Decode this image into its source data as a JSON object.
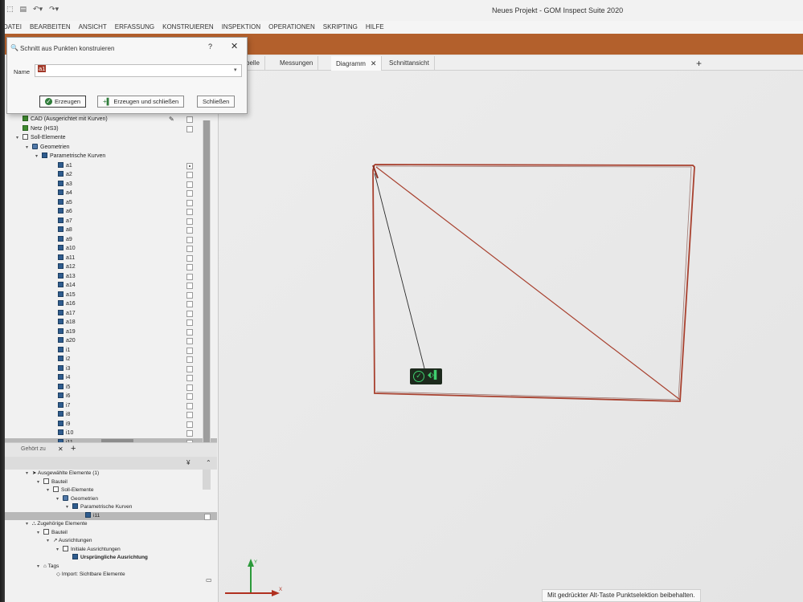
{
  "window": {
    "title": "Neues Projekt - GOM Inspect Suite 2020"
  },
  "menu": [
    "DATEI",
    "BEARBEITEN",
    "ANSICHT",
    "ERFASSUNG",
    "KONSTRUIEREN",
    "INSPEKTION",
    "OPERATIONEN",
    "SKRIPTING",
    "HILFE"
  ],
  "tabs": [
    {
      "label": "belle"
    },
    {
      "label": "Messungen"
    },
    {
      "label": "Diagramm",
      "close": "✕"
    },
    {
      "label": "Schnittansicht"
    }
  ],
  "dialog": {
    "title": "Schnitt aus Punkten konstruieren",
    "help": "?",
    "close": "✕",
    "name_label": "Name",
    "name_value": "a1",
    "buttons": {
      "create": "Erzeugen",
      "create_close": "Erzeugen und schließen",
      "close": "Schließen"
    }
  },
  "tree": [
    "CAD (Ausgerichtet mit Kurven)",
    "Netz (HS3)",
    "Soll-Elemente",
    "Geometrien",
    "Parametrische Kurven"
  ],
  "curves": [
    "a1",
    "a2",
    "a3",
    "a4",
    "a5",
    "a6",
    "a7",
    "a8",
    "a9",
    "a10",
    "a11",
    "a12",
    "a13",
    "a14",
    "a15",
    "a16",
    "a17",
    "a18",
    "a19",
    "a20",
    "i1",
    "i2",
    "i3",
    "i4",
    "i5",
    "i6",
    "i7",
    "i8",
    "i9",
    "i10",
    "i11"
  ],
  "lower": {
    "tab": "Gehört zu",
    "items": [
      "Ausgewählte Elemente (1)",
      "Bauteil",
      "Soll-Elemente",
      "Geometrien",
      "Parametrische Kurven",
      "i11",
      "Zugehörige Elemente",
      "Bauteil",
      "Ausrichtungen",
      "Initiale Ausrichtungen",
      "Ursprüngliche Ausrichtung",
      "Tags",
      "Import: Sichtbare Elemente"
    ]
  },
  "viewport": {
    "status": "Mit gedrückter Alt-Taste Punktselektion beibehalten.",
    "axis_y": "Y",
    "axis_x": "X",
    "accent": "#a8412f"
  }
}
